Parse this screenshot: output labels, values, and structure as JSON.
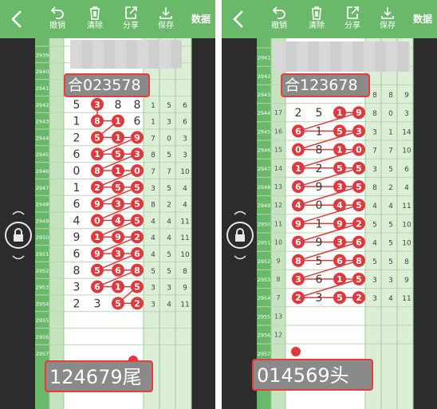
{
  "toolbar": {
    "buttons": [
      "撤销",
      "清除",
      "分享",
      "保存"
    ],
    "right_label": "数据"
  },
  "panels": [
    {
      "periods": [
        "2939",
        "2940",
        "2941",
        "2942",
        "2943",
        "2944",
        "2945",
        "2946",
        "2947",
        "2948",
        "2949",
        "2950",
        "2951",
        "2952",
        "2953",
        "2954",
        "2955",
        "2956",
        "2957"
      ],
      "seq": [
        "",
        "",
        "",
        "",
        "",
        "",
        "",
        "",
        "",
        "",
        "",
        "",
        "",
        "",
        "",
        "",
        "",
        "",
        ""
      ],
      "top_note": "合023578",
      "bottom_note": "124679尾",
      "rows": [
        [],
        [],
        [],
        [
          {
            "d": "5",
            "c": false
          },
          {
            "d": "3",
            "c": true
          },
          {
            "d": "8",
            "c": false
          },
          {
            "d": "8",
            "c": false
          }
        ],
        [
          {
            "d": "1",
            "c": false
          },
          {
            "d": "8",
            "c": true
          },
          {
            "d": "1",
            "c": true
          },
          {
            "d": "6",
            "c": false
          }
        ],
        [
          {
            "d": "2",
            "c": false
          },
          {
            "d": "5",
            "c": true
          },
          {
            "d": "1",
            "c": true
          },
          {
            "d": "9",
            "c": true
          }
        ],
        [
          {
            "d": "6",
            "c": false
          },
          {
            "d": "1",
            "c": true
          },
          {
            "d": "5",
            "c": true
          },
          {
            "d": "3",
            "c": true
          }
        ],
        [
          {
            "d": "0",
            "c": false
          },
          {
            "d": "8",
            "c": true
          },
          {
            "d": "1",
            "c": true
          },
          {
            "d": "0",
            "c": true
          }
        ],
        [
          {
            "d": "1",
            "c": false
          },
          {
            "d": "2",
            "c": true
          },
          {
            "d": "5",
            "c": true
          },
          {
            "d": "5",
            "c": true
          }
        ],
        [
          {
            "d": "6",
            "c": false
          },
          {
            "d": "9",
            "c": true
          },
          {
            "d": "3",
            "c": true
          },
          {
            "d": "5",
            "c": true
          }
        ],
        [
          {
            "d": "4",
            "c": false
          },
          {
            "d": "0",
            "c": true
          },
          {
            "d": "4",
            "c": true
          },
          {
            "d": "5",
            "c": true
          }
        ],
        [
          {
            "d": "9",
            "c": false
          },
          {
            "d": "1",
            "c": true
          },
          {
            "d": "9",
            "c": true
          },
          {
            "d": "2",
            "c": true
          }
        ],
        [
          {
            "d": "6",
            "c": false
          },
          {
            "d": "9",
            "c": true
          },
          {
            "d": "3",
            "c": true
          },
          {
            "d": "6",
            "c": true
          }
        ],
        [
          {
            "d": "8",
            "c": false
          },
          {
            "d": "5",
            "c": true
          },
          {
            "d": "6",
            "c": true
          },
          {
            "d": "8",
            "c": true
          }
        ],
        [
          {
            "d": "3",
            "c": false
          },
          {
            "d": "6",
            "c": true
          },
          {
            "d": "1",
            "c": true
          },
          {
            "d": "5",
            "c": true
          }
        ],
        [
          {
            "d": "2",
            "c": false
          },
          {
            "d": "3",
            "c": false
          },
          {
            "d": "5",
            "c": true
          },
          {
            "d": "2",
            "c": true
          }
        ],
        [],
        [],
        []
      ],
      "extras": [
        [],
        [],
        [],
        [
          "1",
          "5",
          "6"
        ],
        [
          "1",
          "3",
          "6"
        ],
        [
          "7",
          "0",
          "3"
        ],
        [
          "8",
          "5",
          "3"
        ],
        [
          "7",
          "7",
          "10"
        ],
        [
          "3",
          "5",
          "4"
        ],
        [
          "8",
          "2",
          "4"
        ],
        [
          "4",
          "4",
          "11"
        ],
        [
          "4",
          "4",
          "11"
        ],
        [
          "4",
          "5",
          "10"
        ],
        [
          "5",
          "5",
          "8"
        ],
        [
          "3",
          "3",
          "9"
        ],
        [
          "3",
          "4",
          "11"
        ],
        [],
        [],
        []
      ]
    },
    {
      "periods": [
        "2941",
        "2942",
        "2943",
        "2944",
        "2945",
        "2946",
        "2947",
        "2948",
        "2949",
        "2950",
        "2951",
        "2952",
        "2953",
        "2954",
        "2955",
        "2956",
        "2957"
      ],
      "seq": [
        "",
        "",
        "",
        "17",
        "16",
        "15",
        "14",
        "13",
        "12",
        "11",
        "10",
        "9",
        "8",
        "7",
        "13",
        "12",
        ""
      ],
      "top_note": "合123678",
      "bottom_note": "014569头",
      "rows": [
        [],
        [],
        [],
        [
          {
            "d": "2",
            "c": false
          },
          {
            "d": "5",
            "c": false
          },
          {
            "d": "1",
            "c": true
          },
          {
            "d": "9",
            "c": true
          }
        ],
        [
          {
            "d": "6",
            "c": true
          },
          {
            "d": "1",
            "c": false
          },
          {
            "d": "5",
            "c": true
          },
          {
            "d": "3",
            "c": true
          }
        ],
        [
          {
            "d": "0",
            "c": true
          },
          {
            "d": "8",
            "c": false
          },
          {
            "d": "1",
            "c": true
          },
          {
            "d": "0",
            "c": true
          }
        ],
        [
          {
            "d": "1",
            "c": true
          },
          {
            "d": "2",
            "c": false
          },
          {
            "d": "5",
            "c": true
          },
          {
            "d": "5",
            "c": true
          }
        ],
        [
          {
            "d": "6",
            "c": true
          },
          {
            "d": "9",
            "c": false
          },
          {
            "d": "3",
            "c": true
          },
          {
            "d": "5",
            "c": true
          }
        ],
        [
          {
            "d": "4",
            "c": true
          },
          {
            "d": "0",
            "c": false
          },
          {
            "d": "4",
            "c": true
          },
          {
            "d": "5",
            "c": true
          }
        ],
        [
          {
            "d": "9",
            "c": true
          },
          {
            "d": "1",
            "c": false
          },
          {
            "d": "9",
            "c": true
          },
          {
            "d": "2",
            "c": true
          }
        ],
        [
          {
            "d": "6",
            "c": true
          },
          {
            "d": "9",
            "c": false
          },
          {
            "d": "3",
            "c": true
          },
          {
            "d": "6",
            "c": true
          }
        ],
        [
          {
            "d": "8",
            "c": true
          },
          {
            "d": "5",
            "c": false
          },
          {
            "d": "6",
            "c": true
          },
          {
            "d": "8",
            "c": true
          }
        ],
        [
          {
            "d": "3",
            "c": true
          },
          {
            "d": "6",
            "c": false
          },
          {
            "d": "1",
            "c": true
          },
          {
            "d": "5",
            "c": true
          }
        ],
        [
          {
            "d": "2",
            "c": true
          },
          {
            "d": "3",
            "c": false
          },
          {
            "d": "5",
            "c": true
          },
          {
            "d": "2",
            "c": true
          }
        ],
        [],
        [],
        []
      ],
      "extras": [
        [],
        [],
        [
          "8",
          "8",
          "9"
        ],
        [
          "8",
          "0",
          "3"
        ],
        [
          "3",
          "1",
          "14"
        ],
        [
          "7",
          "7",
          "10"
        ],
        [
          "3",
          "5",
          "6"
        ],
        [
          "8",
          "2",
          "4"
        ],
        [
          "4",
          "4",
          "11"
        ],
        [
          "5",
          "5",
          "10"
        ],
        [
          "4",
          "5",
          "10"
        ],
        [
          "5",
          "5",
          "8"
        ],
        [
          "3",
          "3",
          "9"
        ],
        [
          "3",
          "4",
          "11"
        ],
        [],
        [],
        []
      ]
    }
  ]
}
